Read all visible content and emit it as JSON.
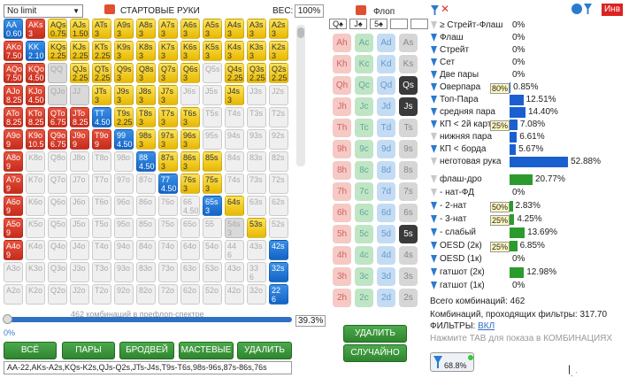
{
  "top": {
    "limit_select": "No limit",
    "start_hands": "СТАРТОВЫЕ РУКИ",
    "weight_label": "ВЕС:",
    "weight_value": "100%",
    "flop_label": "Флоп",
    "invert": "Инв"
  },
  "grid": [
    [
      "AA|0.60",
      "AKs|3",
      "AQs|0.75",
      "AJs|1.50",
      "ATs|3",
      "A9s|3",
      "A8s|3",
      "A7s|3",
      "A6s|3",
      "A5s|3",
      "A4s|3",
      "A3s|3",
      "A2s|3"
    ],
    [
      "AKo|7.50",
      "KK|2.10",
      "KQs|2.25",
      "KJs|2.25",
      "KTs|2.25",
      "K9s|3",
      "K8s|3",
      "K7s|3",
      "K6s|3",
      "K5s|3",
      "K4s|3",
      "K3s|3",
      "K2s|3"
    ],
    [
      "AQo|7.50",
      "KQo|4.50",
      "QQ",
      "QJs|2.25",
      "QTs|2.25",
      "Q9s|3",
      "Q8s|3",
      "Q7s|3",
      "Q6s|3",
      "Q5s",
      "Q4s|2.25",
      "Q3s|2.25",
      "Q2s|2.25"
    ],
    [
      "AJo|8.25",
      "KJo|4.50",
      "QJo",
      "JJ",
      "JTs|3",
      "J9s|3",
      "J8s|3",
      "J7s|3",
      "J6s",
      "J5s",
      "J4s|3",
      "J3s",
      "J2s"
    ],
    [
      "ATo|8.25",
      "KTo|8.25",
      "QTo|6.75",
      "JTo|8.25",
      "TT|4.50",
      "T9s|2.25",
      "T8s|3",
      "T7s|3",
      "T6s|3",
      "T5s",
      "T4s",
      "T3s",
      "T2s"
    ],
    [
      "A9o|9",
      "K9o|10.50",
      "Q9o|6.75",
      "J9o|9",
      "T9o|9",
      "99|4.50",
      "98s|3",
      "97s|3",
      "96s|3",
      "95s",
      "94s",
      "93s",
      "92s"
    ],
    [
      "A8o|9",
      "K8o",
      "Q8o",
      "J8o",
      "T8o",
      "98o",
      "88|4.50",
      "87s|3",
      "86s|3",
      "85s",
      "84s",
      "83s",
      "82s"
    ],
    [
      "A7o|9",
      "K7o",
      "Q7o",
      "J7o",
      "T7o",
      "97o",
      "87o",
      "77|4.50",
      "76s|3",
      "75s|3",
      "74s",
      "73s",
      "72s"
    ],
    [
      "A6o|9",
      "K6o",
      "Q6o",
      "J6o",
      "T6o",
      "96o",
      "86o",
      "76o",
      "66|4.50",
      "65s|3",
      "64s",
      "63s",
      "62s"
    ],
    [
      "A5o|9",
      "K5o",
      "Q5o",
      "J5o",
      "T5o",
      "95o",
      "85o",
      "75o",
      "65o",
      "55",
      "54s|3",
      "53s",
      "52s"
    ],
    [
      "A4o|9",
      "K4o",
      "Q4o",
      "J4o",
      "T4o",
      "94o",
      "84o",
      "74o",
      "64o",
      "54o",
      "44|6",
      "43s",
      "42s"
    ],
    [
      "A3o",
      "K3o",
      "Q3o",
      "J3o",
      "T3o",
      "93o",
      "83o",
      "73o",
      "63o",
      "53o",
      "43o",
      "33|6",
      "32s"
    ],
    [
      "A2o",
      "K2o",
      "Q2o",
      "J2o",
      "T2o",
      "92o",
      "82o",
      "72o",
      "62o",
      "52o",
      "42o",
      "32o",
      "22|6"
    ]
  ],
  "grid_colors": [
    "bryyyyyyyyyyy",
    "rbyyyyyyyyyyy",
    "rrdyyyyyygyyy",
    "rrddyyyyggyggg",
    "rrrrbyyyyggggg",
    "rrrrrbyyygggg",
    "rgggggbyyyggg",
    "rggggggbyyggg",
    "rggggggggbygg",
    "rgggggggggdyggg",
    "rgggggggggggbgg",
    "ggggggggggggbg",
    "ggggggggggggb"
  ],
  "spectrum": {
    "label": "462 комбинаций в префлоп-спектре",
    "percent": "39.3%",
    "slider_min": "0%"
  },
  "buttons": {
    "all": "ВСЁ",
    "pairs": "ПАРЫ",
    "broadway": "БРОДВЕЙ",
    "suited": "МАСТЕВЫЕ",
    "delete": "УДАЛИТЬ"
  },
  "range_text": "AA-22,AKs-A2s,KQs-K2s,QJs-Q2s,JTs-J4s,T9s-T6s,98s-96s,87s-86s,76s",
  "flop": {
    "cards": [
      "Q♠",
      "J♠",
      "5♠"
    ],
    "delete": "УДАЛИТЬ",
    "random": "СЛУЧАЙНО",
    "ranks": [
      "A",
      "K",
      "Q",
      "J",
      "T",
      "9",
      "8",
      "7",
      "6",
      "5",
      "4",
      "3",
      "2"
    ],
    "suits": [
      "h",
      "c",
      "d",
      "s"
    ]
  },
  "filters": [
    {
      "name": "≥ Стрейт-Флаш",
      "value": "0%",
      "bar": 0
    },
    {
      "name": "Флаш",
      "value": "0%",
      "bar": 0
    },
    {
      "name": "Стрейт",
      "value": "0%",
      "bar": 0
    },
    {
      "name": "Сет",
      "value": "0%",
      "bar": 0
    },
    {
      "name": "Две пары",
      "value": "0%",
      "bar": 0
    },
    {
      "name": "Оверпара",
      "value": "0.85%",
      "bar": 0.9,
      "badge": "80%"
    },
    {
      "name": "Топ-Пара",
      "value": "12.51%",
      "bar": 12.51
    },
    {
      "name": "средняя пара",
      "value": "14.40%",
      "bar": 14.4
    },
    {
      "name": "КП < 2й карт",
      "value": "7.08%",
      "bar": 7.08,
      "badge": "25%"
    },
    {
      "name": "нижняя пара",
      "value": "6.61%",
      "bar": 6.61
    },
    {
      "name": "КП < борда",
      "value": "5.67%",
      "bar": 5.67
    },
    {
      "name": "неготовая рука",
      "value": "52.88%",
      "bar": 52.88
    }
  ],
  "draws": [
    {
      "name": "флаш-дро",
      "value": "20.77%",
      "bar": 20.77
    },
    {
      "name": "- нат-ФД",
      "value": "0%",
      "bar": 0
    },
    {
      "name": "- 2-нат",
      "value": "2.83%",
      "bar": 2.83,
      "badge": "50%"
    },
    {
      "name": "- 3-нат",
      "value": "4.25%",
      "bar": 4.25,
      "badge": "25%"
    },
    {
      "name": "- слабый",
      "value": "13.69%",
      "bar": 13.69
    },
    {
      "name": "OESD (2к)",
      "value": "6.85%",
      "bar": 6.85,
      "badge": "25%"
    },
    {
      "name": "OESD (1к)",
      "value": "0%",
      "bar": 0
    },
    {
      "name": "гатшот (2к)",
      "value": "12.98%",
      "bar": 12.98
    },
    {
      "name": "гатшот (1к)",
      "value": "0%",
      "bar": 0
    }
  ],
  "summary": {
    "total": "Всего комбинаций: 462",
    "passed": "Комбинаций, проходящих фильтры: 317.70",
    "filters_on": "ФИЛЬТРЫ:",
    "filters_on_val": "ВКЛ",
    "hint": "Нажмите TAB для показа в КОМБИНАЦИЯХ",
    "gauge": "68.8%"
  }
}
